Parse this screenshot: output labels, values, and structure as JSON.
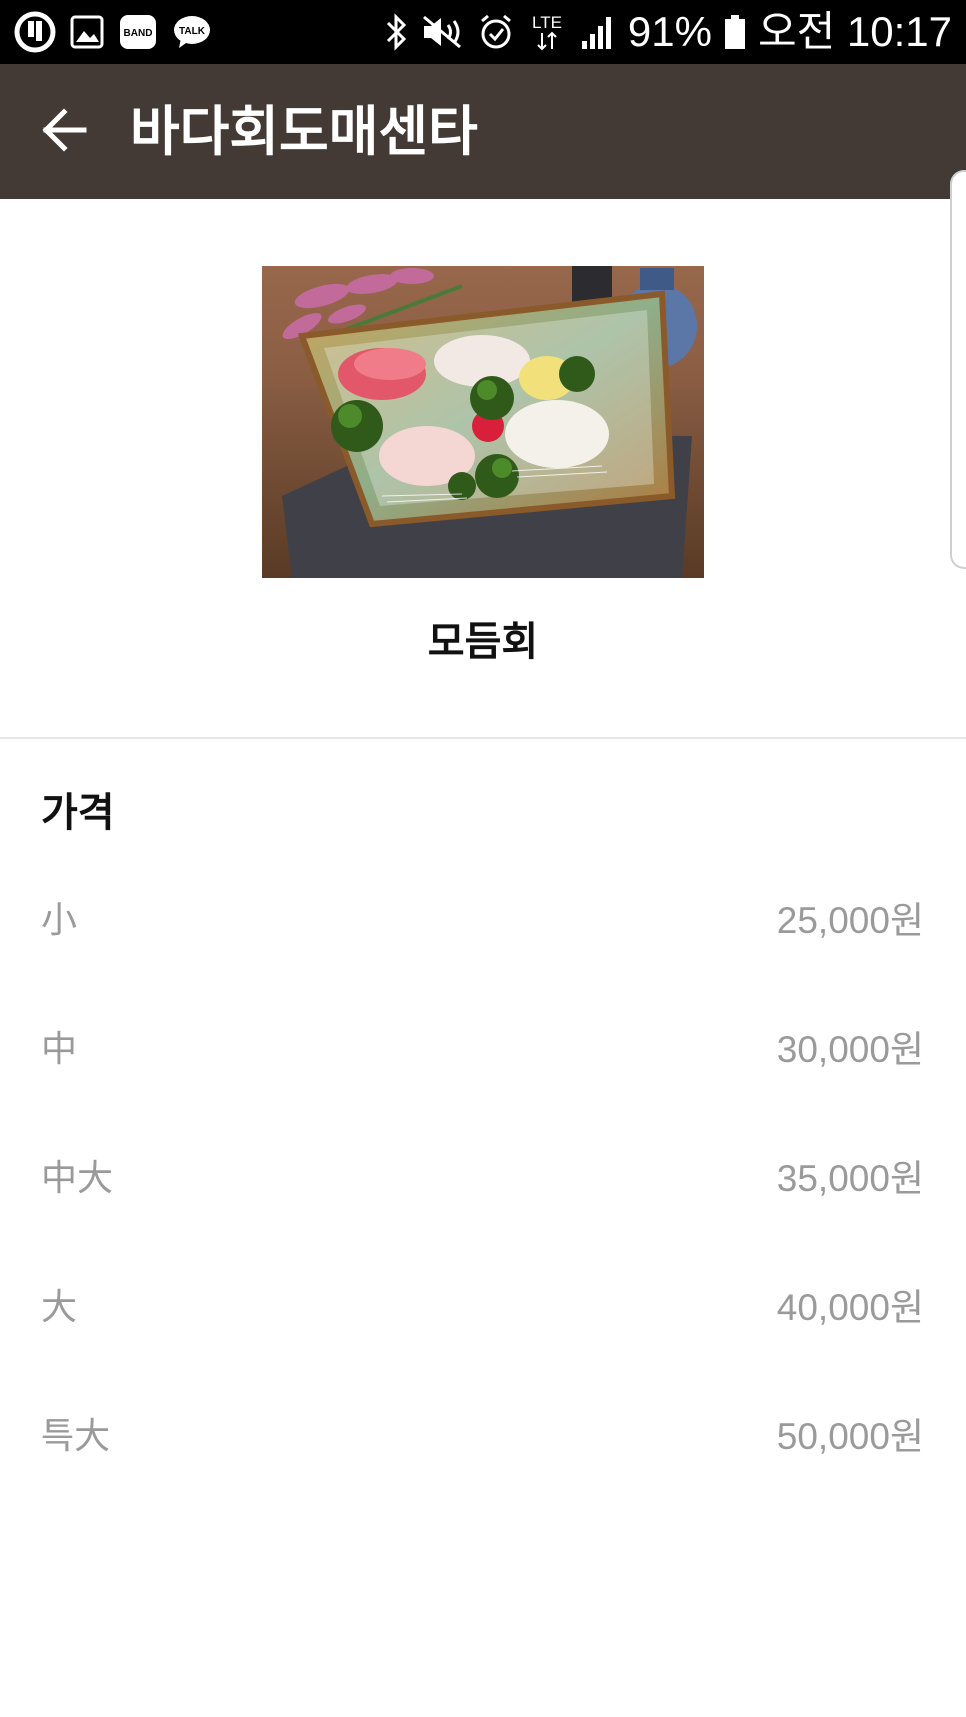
{
  "status_bar": {
    "battery": "91%",
    "time": "오전 10:17",
    "network": "LTE",
    "left_icons": [
      "u-plus-icon",
      "gallery-icon",
      "band-icon",
      "kakaotalk-icon"
    ],
    "right_icons": [
      "bluetooth-icon",
      "mute-icon",
      "alarm-icon",
      "lte-icon",
      "signal-icon",
      "battery-icon"
    ],
    "band_label": "BAND",
    "talk_label": "TALK"
  },
  "app_bar": {
    "title": "바다회도매센타",
    "background": "#433a35"
  },
  "product": {
    "name": "모듬회",
    "image": "sashimi-platter-photo"
  },
  "prices": {
    "heading": "가격",
    "items": [
      {
        "size": "小",
        "price": "25,000원"
      },
      {
        "size": "中",
        "price": "30,000원"
      },
      {
        "size": "中大",
        "price": "35,000원"
      },
      {
        "size": "大",
        "price": "40,000원"
      },
      {
        "size": "특大",
        "price": "50,000원"
      }
    ]
  }
}
